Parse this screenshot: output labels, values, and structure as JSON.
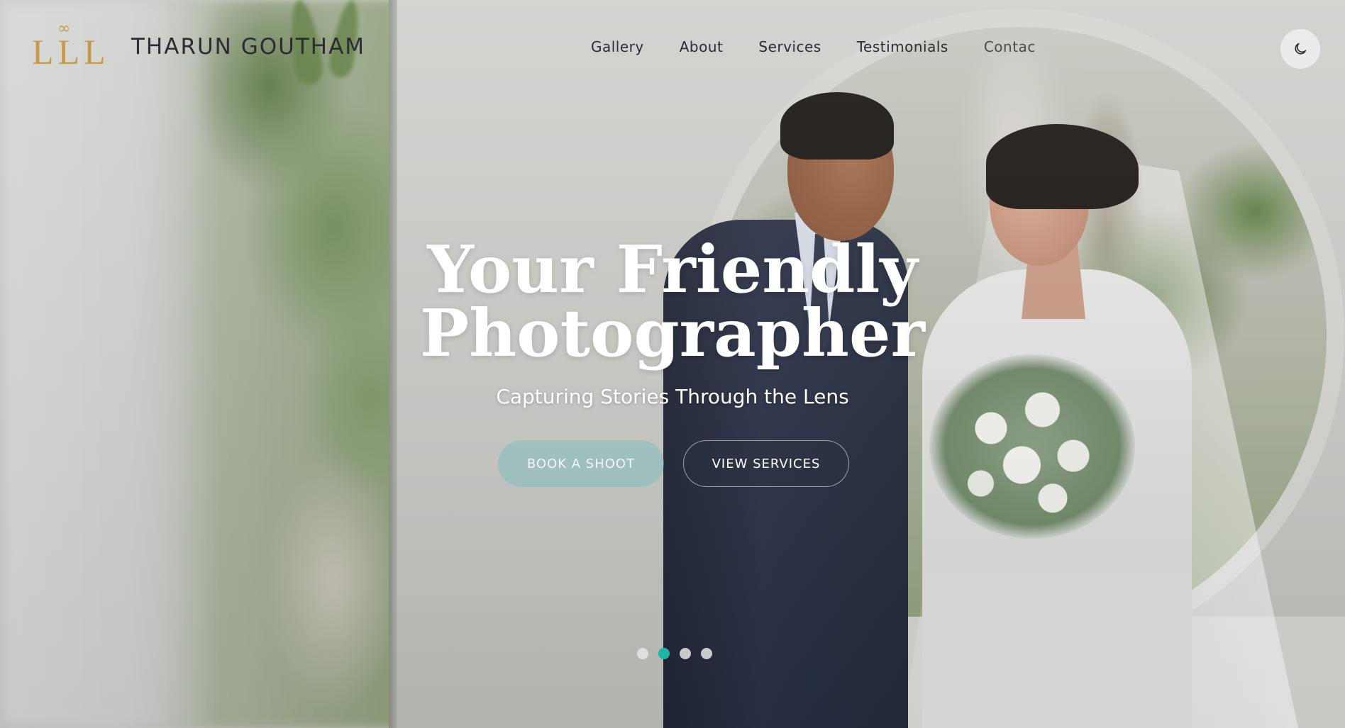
{
  "brand": {
    "name": "THARUN GOUTHAM",
    "logo_letters": "LLL",
    "logo_symbol": "∞",
    "logo_color": "#c9994a"
  },
  "nav": {
    "items": [
      {
        "label": "Gallery"
      },
      {
        "label": "About"
      },
      {
        "label": "Services"
      },
      {
        "label": "Testimonials"
      },
      {
        "label": "Contac"
      }
    ]
  },
  "theme_toggle": {
    "icon": "moon-icon"
  },
  "hero": {
    "title_line1": "Your Friendly",
    "title_line2": "Photographer",
    "subtitle": "Capturing Stories Through the Lens",
    "primary_button": "BOOK A SHOOT",
    "secondary_button": "VIEW SERVICES"
  },
  "slider": {
    "slide_count": 4,
    "active_index": 1,
    "active_color": "#1fb5a5"
  }
}
